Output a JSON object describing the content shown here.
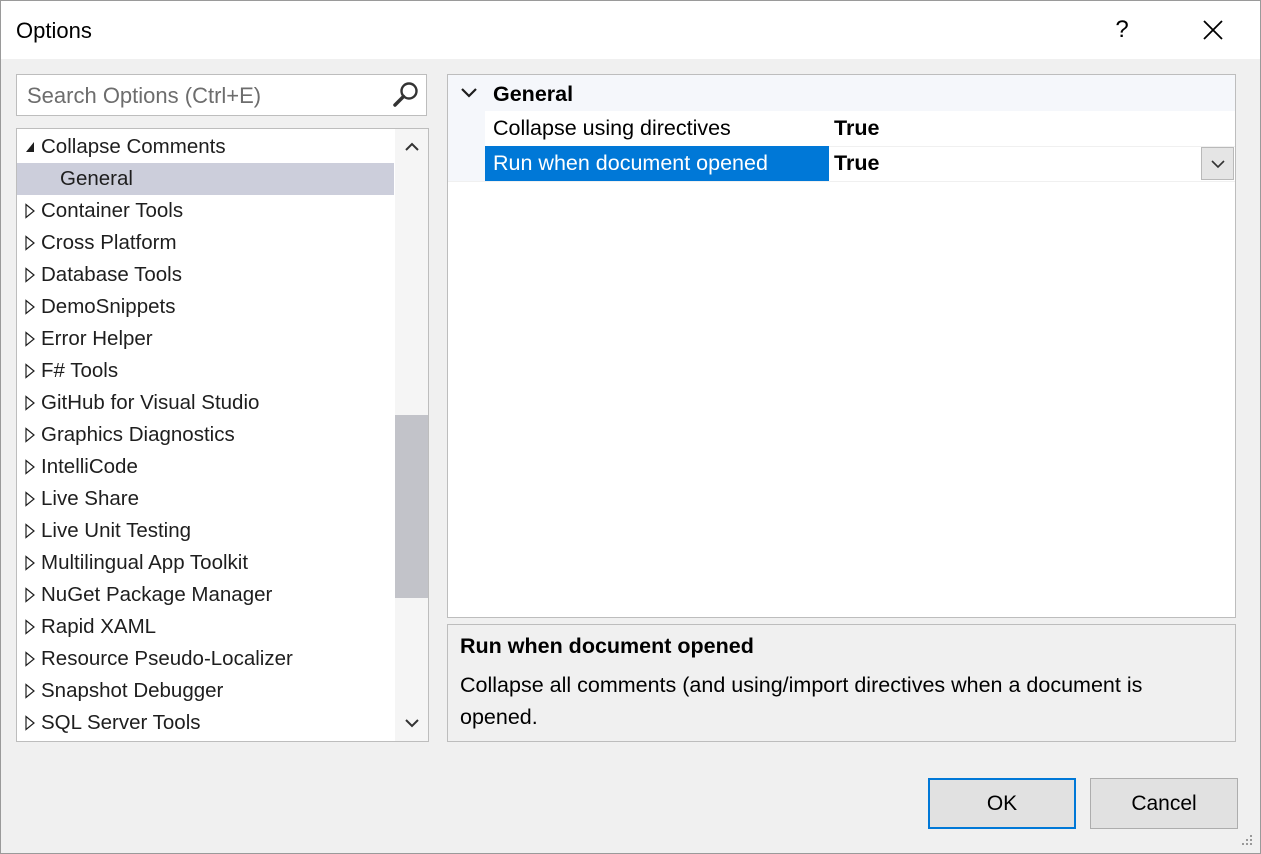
{
  "window": {
    "title": "Options",
    "help_glyph": "?"
  },
  "search": {
    "placeholder": "Search Options (Ctrl+E)",
    "value": ""
  },
  "tree": {
    "items": [
      {
        "label": "Collapse Comments",
        "expanded": true,
        "level": 0
      },
      {
        "label": "General",
        "level": 1,
        "selected": true
      },
      {
        "label": "Container Tools",
        "level": 0
      },
      {
        "label": "Cross Platform",
        "level": 0
      },
      {
        "label": "Database Tools",
        "level": 0
      },
      {
        "label": "DemoSnippets",
        "level": 0
      },
      {
        "label": "Error Helper",
        "level": 0
      },
      {
        "label": "F# Tools",
        "level": 0
      },
      {
        "label": "GitHub for Visual Studio",
        "level": 0
      },
      {
        "label": "Graphics Diagnostics",
        "level": 0
      },
      {
        "label": "IntelliCode",
        "level": 0
      },
      {
        "label": "Live Share",
        "level": 0
      },
      {
        "label": "Live Unit Testing",
        "level": 0
      },
      {
        "label": "Multilingual App Toolkit",
        "level": 0
      },
      {
        "label": "NuGet Package Manager",
        "level": 0
      },
      {
        "label": "Rapid XAML",
        "level": 0
      },
      {
        "label": "Resource Pseudo-Localizer",
        "level": 0
      },
      {
        "label": "Snapshot Debugger",
        "level": 0
      },
      {
        "label": "SQL Server Tools",
        "level": 0
      }
    ]
  },
  "property_grid": {
    "category": "General",
    "properties": [
      {
        "name": "Collapse using directives",
        "value": "True"
      },
      {
        "name": "Run when document opened",
        "value": "True",
        "selected": true
      }
    ]
  },
  "description": {
    "title": "Run when document opened",
    "text": "Collapse all comments (and using/import directives when a document is opened."
  },
  "buttons": {
    "ok": "OK",
    "cancel": "Cancel"
  },
  "colors": {
    "accent": "#0078d7",
    "tree_selection": "#cccedb"
  }
}
